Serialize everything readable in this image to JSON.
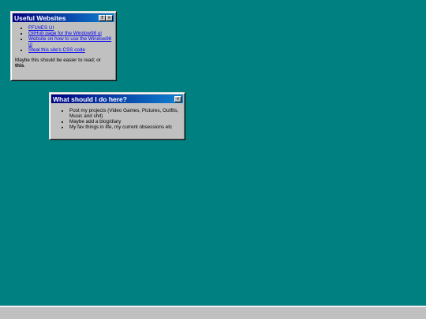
{
  "window1": {
    "title": "Useful Websites",
    "help_label": "?",
    "close_label": "✕",
    "links": [
      "FF1NES UI",
      "GitHub page for the Window98 ui",
      "Website on how to use the Window98 ui",
      "Steal this site's CSS code"
    ],
    "note_text": "Maybe this should be easier to read; or ",
    "note_bold": "this",
    "note_end": "."
  },
  "window2": {
    "title": "What should I do here?",
    "close_label": "✕",
    "items": [
      "Post my projects (Video Games, Pictures, Outfits, Music and shit)",
      "Maybe add a blog/diary",
      "My fav things in life, my current obsessions etc"
    ]
  },
  "colors": {
    "desktop": "#008080",
    "title_gradient_start": "#000080",
    "title_gradient_end": "#1084d0",
    "window_face": "#c0c0c0"
  }
}
